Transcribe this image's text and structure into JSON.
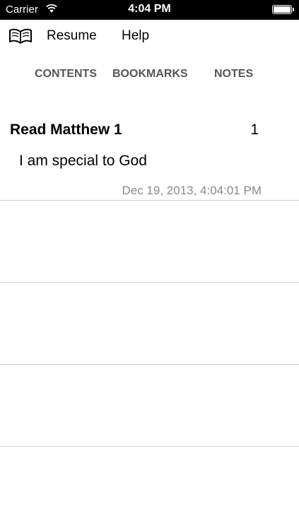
{
  "status_bar": {
    "carrier": "Carrier",
    "time": "4:04 PM",
    "battery_level": 1.0
  },
  "nav": {
    "icon": "open-book-icon",
    "resume_label": "Resume",
    "help_label": "Help"
  },
  "tabs": [
    {
      "label": "CONTENTS"
    },
    {
      "label": "BOOKMARKS"
    },
    {
      "label": "NOTES"
    }
  ],
  "notes": [
    {
      "title": "Read Matthew 1",
      "count": "1",
      "text": "I am special to God",
      "date": "Dec 19, 2013, 4:04:01 PM"
    }
  ]
}
